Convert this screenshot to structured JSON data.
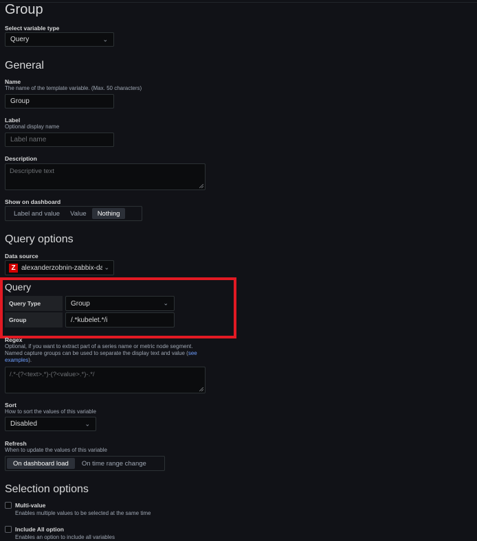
{
  "page_title": "Group",
  "variable_type": {
    "label": "Select variable type",
    "value": "Query"
  },
  "general": {
    "heading": "General",
    "name": {
      "label": "Name",
      "description": "The name of the template variable. (Max. 50 characters)",
      "value": "Group"
    },
    "label": {
      "label": "Label",
      "description": "Optional display name",
      "placeholder": "Label name"
    },
    "description": {
      "label": "Description",
      "placeholder": "Descriptive text"
    },
    "show_on_dashboard": {
      "label": "Show on dashboard",
      "options": [
        "Label and value",
        "Value",
        "Nothing"
      ],
      "selected": "Nothing"
    }
  },
  "query_options": {
    "heading": "Query options",
    "data_source": {
      "label": "Data source",
      "icon_letter": "Z",
      "value": "alexanderzobnin-zabbix-da"
    },
    "query": {
      "heading": "Query",
      "query_type": {
        "label": "Query Type",
        "value": "Group"
      },
      "group": {
        "label": "Group",
        "value": "/.*kubelet.*/i"
      }
    },
    "regex": {
      "label": "Regex",
      "description_1": "Optional, if you want to extract part of a series name or metric node segment.",
      "description_2": "Named capture groups can be used to separate the display text and value (",
      "link_part_1": "see",
      "link_part_2": "examples",
      "description_end": ").",
      "placeholder": "/.*-(?<text>.*)-(?<value>.*)-.*/"
    },
    "sort": {
      "label": "Sort",
      "description": "How to sort the values of this variable",
      "value": "Disabled"
    },
    "refresh": {
      "label": "Refresh",
      "description": "When to update the values of this variable",
      "options": [
        "On dashboard load",
        "On time range change"
      ],
      "selected": "On dashboard load"
    }
  },
  "selection_options": {
    "heading": "Selection options",
    "multi_value": {
      "label": "Multi-value",
      "description": "Enables multiple values to be selected at the same time"
    },
    "include_all": {
      "label": "Include All option",
      "description": "Enables an option to include all variables"
    }
  },
  "colors": {
    "highlight": "#e21a23",
    "background": "#111217",
    "accent_link": "#6e9fff"
  }
}
